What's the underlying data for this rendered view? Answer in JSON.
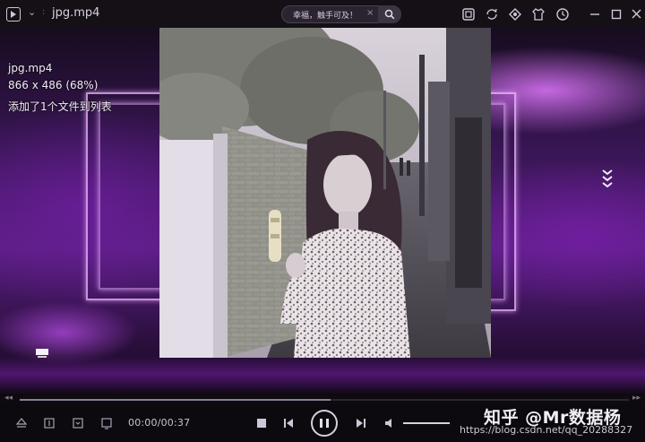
{
  "window": {
    "title": "jpg.mp4",
    "menu_chevron": "⌄",
    "title_separator": ":"
  },
  "search": {
    "text": "幸福，触手可及！",
    "clear": "×"
  },
  "toolbar_icons": [
    "screenshot-icon",
    "refresh-icon",
    "skin-icon",
    "shirt-icon",
    "history-clock-icon",
    "minimize-icon",
    "maximize-icon",
    "close-icon"
  ],
  "overlay": {
    "filename": "jpg.mp4",
    "resolution": "866 x 486 (68%)",
    "status": "添加了1个文件到列表"
  },
  "playback": {
    "time": "00:00/00:37",
    "progress_fraction": 0.51,
    "volume_fraction": 1.0
  },
  "watermark": {
    "brand": "知乎 @Mr数据杨",
    "url": "https://blog.csdn.net/qq_20288327"
  },
  "colors": {
    "accent_purple": "#7b2aa8",
    "glow_pink": "#e8a8ff",
    "titlebar_bg": "#141016",
    "controls_bg": "#0c0a0e"
  }
}
